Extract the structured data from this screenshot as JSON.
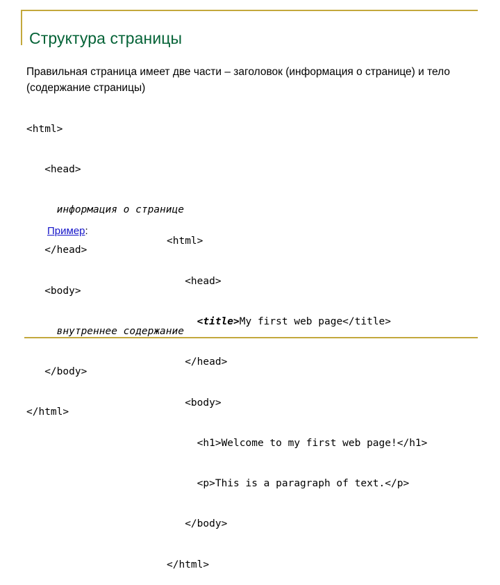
{
  "slide": {
    "title": "Структура страницы",
    "intro": "Правильная страница имеет две части – заголовок (информация о странице) и тело (содержание страницы)",
    "accent_color": "#c3a83c",
    "title_color": "#056337",
    "link_color": "#1414c8",
    "background_color": "#ffffff"
  },
  "structure_code": {
    "lines": [
      "<html>",
      "   <head>",
      "     информация о странице",
      "   </head>",
      "   <body>",
      "     внутреннее содержание",
      "   </body>",
      "</html>"
    ],
    "italic_line_indexes": [
      2,
      5
    ]
  },
  "example_label": {
    "link_text": "Пример",
    "suffix": ":"
  },
  "example_code": {
    "line_1": "<html>",
    "line_2": "   <head>",
    "line_3_indent": "     ",
    "line_3_tag_open": "<title>",
    "line_3_text": "My first web page",
    "line_3_tag_close": "</title>",
    "line_4": "   </head>",
    "line_5": "   <body>",
    "line_6": "     <h1>Welcome to my first web page!</h1>",
    "line_7": "     <p>This is a paragraph of text.</p>",
    "line_8": "   </body>",
    "line_9": "</html>"
  }
}
